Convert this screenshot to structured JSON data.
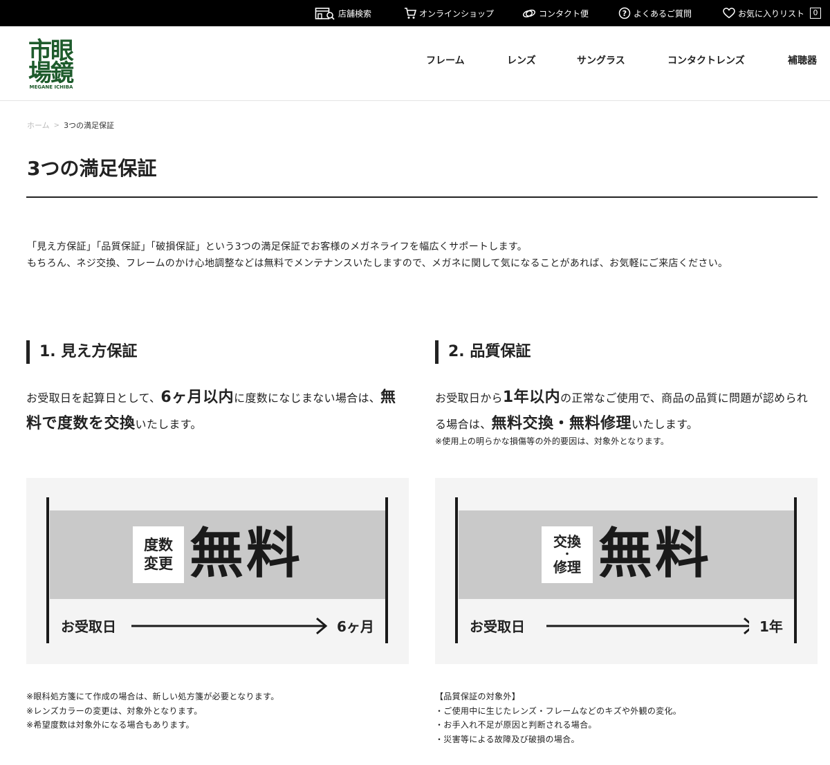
{
  "topbar": {
    "store_search": "店舗検索",
    "online_shop": "オンラインショップ",
    "contact_bin": "コンタクト便",
    "faq": "よくあるご質問",
    "favorites": "お気に入りリスト",
    "favorites_count": "0",
    "icons": [
      "store-icon",
      "cart-icon",
      "lens-icon",
      "question-icon",
      "heart-icon"
    ]
  },
  "logo": {
    "text": "市場眼鏡",
    "sub": "MEGANE ICHIBA",
    "color": "#1e5b2c"
  },
  "nav": [
    "フレーム",
    "レンズ",
    "サングラス",
    "コンタクトレンズ",
    "補聴器"
  ],
  "breadcrumb": {
    "home": "ホーム",
    "separator": ">",
    "current": "3つの満足保証"
  },
  "page_title": "3つの満足保証",
  "intro": {
    "line1": "「見え方保証」「品質保証」「破損保証」という3つの満足保証でお客様のメガネライフを幅広くサポートします。",
    "line2": "もちろん、ネジ交換、フレームのかけ心地調整などは無料でメンテナンスいたしますので、メガネに関して気になることがあれば、お気軽にご来店ください。"
  },
  "sections": [
    {
      "title": "1. 見え方保証",
      "lead": {
        "t1": "お受取日を起算日として、",
        "b1": "6ヶ月以内",
        "t2": "に度数になじまない場合は、",
        "b2": "無料で度数を交換",
        "t3": "いたします。"
      },
      "graphic": {
        "tag_line1": "度数",
        "tag_line2": "変更",
        "free": "無料",
        "from": "お受取日",
        "to": "6ヶ月"
      },
      "notes": [
        "※眼科処方箋にて作成の場合は、新しい処方箋が必要となります。",
        "※レンズカラーの変更は、対象外となります。",
        "※希望度数は対象外になる場合もあります。"
      ]
    },
    {
      "title": "2. 品質保証",
      "lead": {
        "t1": "お受取日から",
        "b1": "1年以内",
        "t2": "の正常なご使用で、商品の品質に問題が認められる場合は、",
        "b2": "無料交換・無料修理",
        "t3": "いたします。"
      },
      "subnote": "※使用上の明らかな損傷等の外的要因は、対象外となります。",
      "graphic": {
        "tag_line1": "交換",
        "tag_dot": "・",
        "tag_line2": "修理",
        "free": "無料",
        "from": "お受取日",
        "to": "1年"
      },
      "notes": [
        "【品質保証の対象外】",
        "・ご使用中に生じたレンズ・フレームなどのキズや外観の変化。",
        "・お手入れ不足が原因と判断される場合。",
        "・災害等による故障及び破損の場合。"
      ]
    }
  ]
}
